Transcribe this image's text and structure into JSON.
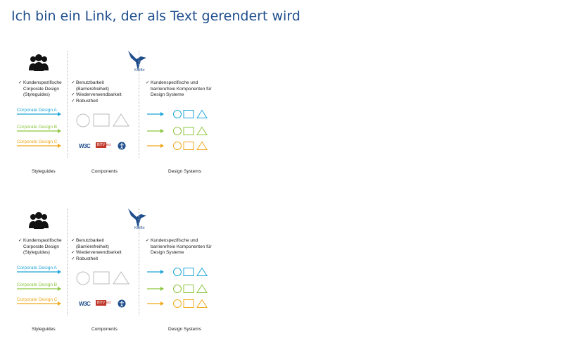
{
  "page": {
    "title_link": "Ich bin ein Link, der als Text gerendert wird"
  },
  "diagram": {
    "logo_text": "KoliBri",
    "styleguides_checks": [
      "Kundenspezifische Corporate Design (Styleguides)"
    ],
    "components_checks": [
      "Benutzbarkeit (Barrierefreiheit)",
      "Wiederverwendbarkeit",
      "Robustheit"
    ],
    "design_systems_checks": [
      "Kundenspezifische und barrierefreie Komponenten für Design Systeme"
    ],
    "corporate_designs": [
      {
        "label": "Corporate Design A",
        "color": "#1ea5d8"
      },
      {
        "label": "Corporate Design B",
        "color": "#8cc63f"
      },
      {
        "label": "Corporate Design C",
        "color": "#f0a81b"
      }
    ],
    "badges": {
      "w3c": "W3C",
      "bitv": "BITV",
      "bitv_sub": "Test"
    },
    "columns": [
      "Styleguides",
      "Components",
      "Design Systems"
    ],
    "icons": [
      "people-icon",
      "kolibri-bird-logo",
      "checkmark-icon",
      "arrow-right-icon",
      "circle-shape",
      "square-shape",
      "triangle-shape",
      "accessibility-icon"
    ],
    "colors": {
      "outline_gray": "#bbbbbb",
      "title_blue": "#1f4e8c"
    }
  }
}
